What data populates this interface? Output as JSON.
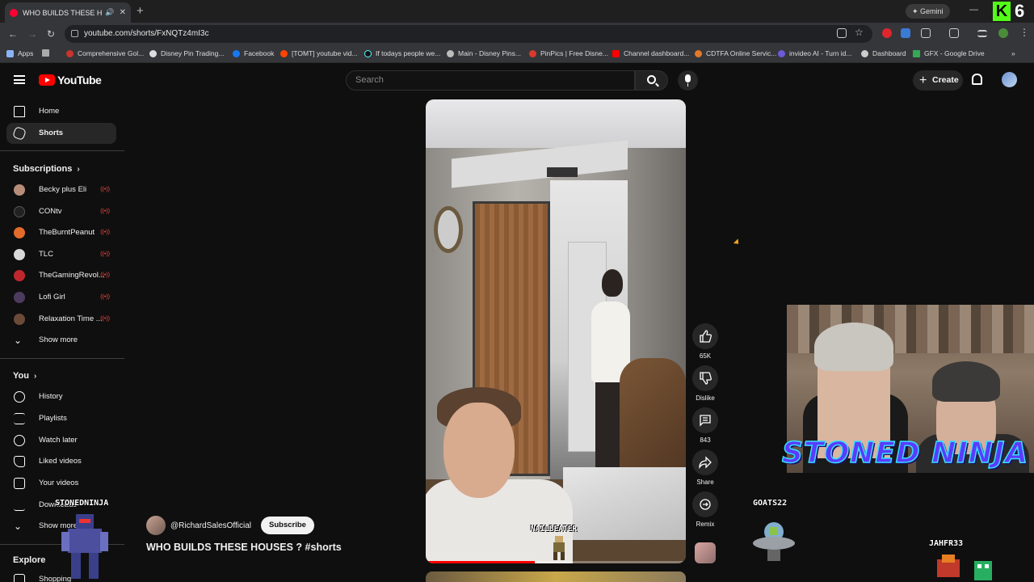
{
  "browser": {
    "tab_title": "WHO BUILDS THESE HOUS",
    "url": "youtube.com/shorts/FxNQTz4mI3c",
    "gemini_label": "Gemini",
    "kick_badge": "K",
    "kick_count": "6",
    "bookmarks": [
      "Apps",
      "Comprehensive Gol...",
      "Disney Pin Trading...",
      "Facebook",
      "[TOMT] youtube vid...",
      "If todays people we...",
      "Main - Disney Pins...",
      "PinPics | Free Disne...",
      "Channel dashboard...",
      "CDTFA Online Servic...",
      "invideo AI - Turn id...",
      "Dashboard",
      "GFX - Google Drive"
    ]
  },
  "header": {
    "logo_text": "YouTube",
    "search_placeholder": "Search",
    "create_label": "Create"
  },
  "sidebar": {
    "main": [
      {
        "label": "Home",
        "icon": "home-icon"
      },
      {
        "label": "Shorts",
        "icon": "shorts-icon",
        "active": true
      }
    ],
    "subscriptions_heading": "Subscriptions",
    "subscriptions": [
      {
        "label": "Becky plus Eli",
        "color": "#b78d7a",
        "live": true
      },
      {
        "label": "CONtv",
        "color": "#222222",
        "live": true
      },
      {
        "label": "TheBurntPeanut",
        "color": "#e36b2c",
        "live": true
      },
      {
        "label": "TLC",
        "color": "#d8d8d8",
        "live": true
      },
      {
        "label": "TheGamingRevol...",
        "color": "#c0272d",
        "live": true
      },
      {
        "label": "Lofi Girl",
        "color": "#4d3b5e",
        "live": true
      },
      {
        "label": "Relaxation Time ...",
        "color": "#6b4a3a",
        "live": true
      }
    ],
    "show_more": "Show more",
    "you_heading": "You",
    "you_items": [
      {
        "label": "History",
        "icon": "history-icon"
      },
      {
        "label": "Playlists",
        "icon": "playlists-icon"
      },
      {
        "label": "Watch later",
        "icon": "watch-later-icon"
      },
      {
        "label": "Liked videos",
        "icon": "liked-videos-icon"
      },
      {
        "label": "Your videos",
        "icon": "your-videos-icon"
      },
      {
        "label": "Downloads",
        "icon": "downloads-icon"
      },
      {
        "label": "Show more",
        "icon": "chevron-down-icon"
      }
    ],
    "explore_heading": "Explore",
    "explore_items": [
      {
        "label": "Shopping",
        "icon": "shopping-icon"
      }
    ]
  },
  "video": {
    "overlay_text": "NAILBEATER",
    "progress": 0.42
  },
  "actions": [
    {
      "name": "like",
      "label": "65K"
    },
    {
      "name": "dislike",
      "label": "Dislike"
    },
    {
      "name": "comments",
      "label": "843"
    },
    {
      "name": "share",
      "label": "Share"
    },
    {
      "name": "remix",
      "label": "Remix"
    }
  ],
  "channel": {
    "handle": "@RichardSalesOfficial",
    "subscribe_label": "Subscribe",
    "video_title": "WHO BUILDS THESE HOUSES ? #shorts"
  },
  "stream_overlay": {
    "logo_text": "STONED NINJA",
    "names": {
      "left": "STONEDNINJA",
      "center": "GOATS22",
      "right": "JAHFR33"
    }
  },
  "colors": {
    "youtube_red": "#ff0000",
    "background": "#0f0f0f",
    "live_indicator": "#ff4e45",
    "kick_green": "#53fc18"
  }
}
